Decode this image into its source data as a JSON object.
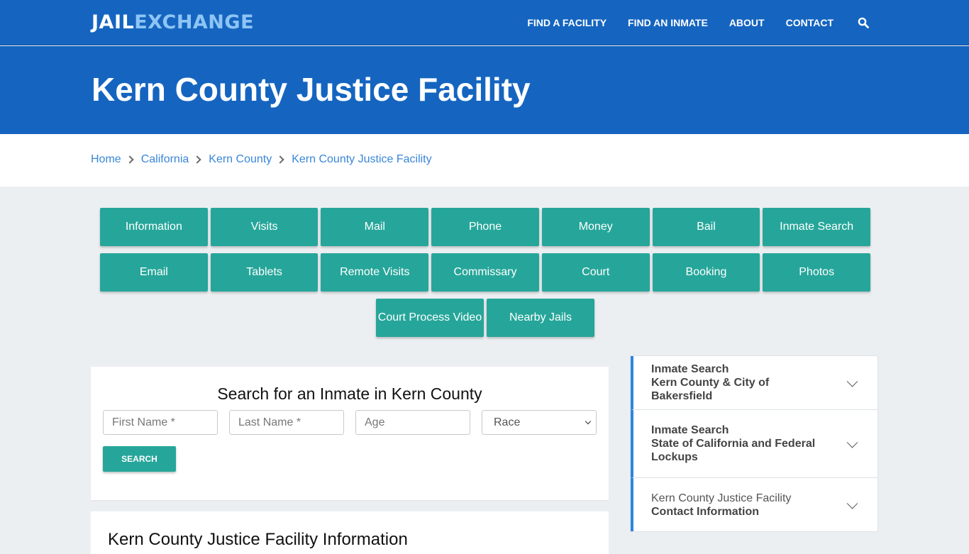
{
  "header": {
    "logo": {
      "part1": "JAIL",
      "part2": "EXCHANGE"
    },
    "nav": [
      {
        "label": "FIND A FACILITY"
      },
      {
        "label": "FIND AN INMATE"
      },
      {
        "label": "ABOUT"
      },
      {
        "label": "CONTACT"
      }
    ],
    "search_icon": "search-icon"
  },
  "hero": {
    "title": "Kern County Justice Facility"
  },
  "breadcrumb": [
    {
      "label": "Home"
    },
    {
      "label": "California"
    },
    {
      "label": "Kern County"
    },
    {
      "label": "Kern County Justice Facility"
    }
  ],
  "topic_buttons": {
    "row1": [
      "Information",
      "Visits",
      "Mail",
      "Phone",
      "Money",
      "Bail",
      "Inmate Search"
    ],
    "row2": [
      "Email",
      "Tablets",
      "Remote Visits",
      "Commissary",
      "Court",
      "Booking",
      "Photos"
    ],
    "row3": [
      "Court Process Video",
      "Nearby Jails"
    ]
  },
  "search_form": {
    "title": "Search for an Inmate in Kern County",
    "first_name_placeholder": "First Name *",
    "last_name_placeholder": "Last Name *",
    "age_placeholder": "Age",
    "race_selected": "Race",
    "submit_label": "SEARCH"
  },
  "info_section": {
    "title": "Kern County Justice Facility Information"
  },
  "sidebar": {
    "items": [
      {
        "line1": "Inmate Search",
        "line2": "Kern County & City of Bakersfield"
      },
      {
        "line1": "Inmate Search",
        "line2": "State of California and Federal Lockups"
      },
      {
        "line1": "Kern County Justice Facility",
        "line2": "Contact Information"
      }
    ]
  },
  "colors": {
    "brand_blue": "#1565c0",
    "logo_accent": "#8ec5f5",
    "teal_button": "#26a69a",
    "link_blue": "#3a86d8",
    "sidebar_accent": "#2e86de"
  }
}
